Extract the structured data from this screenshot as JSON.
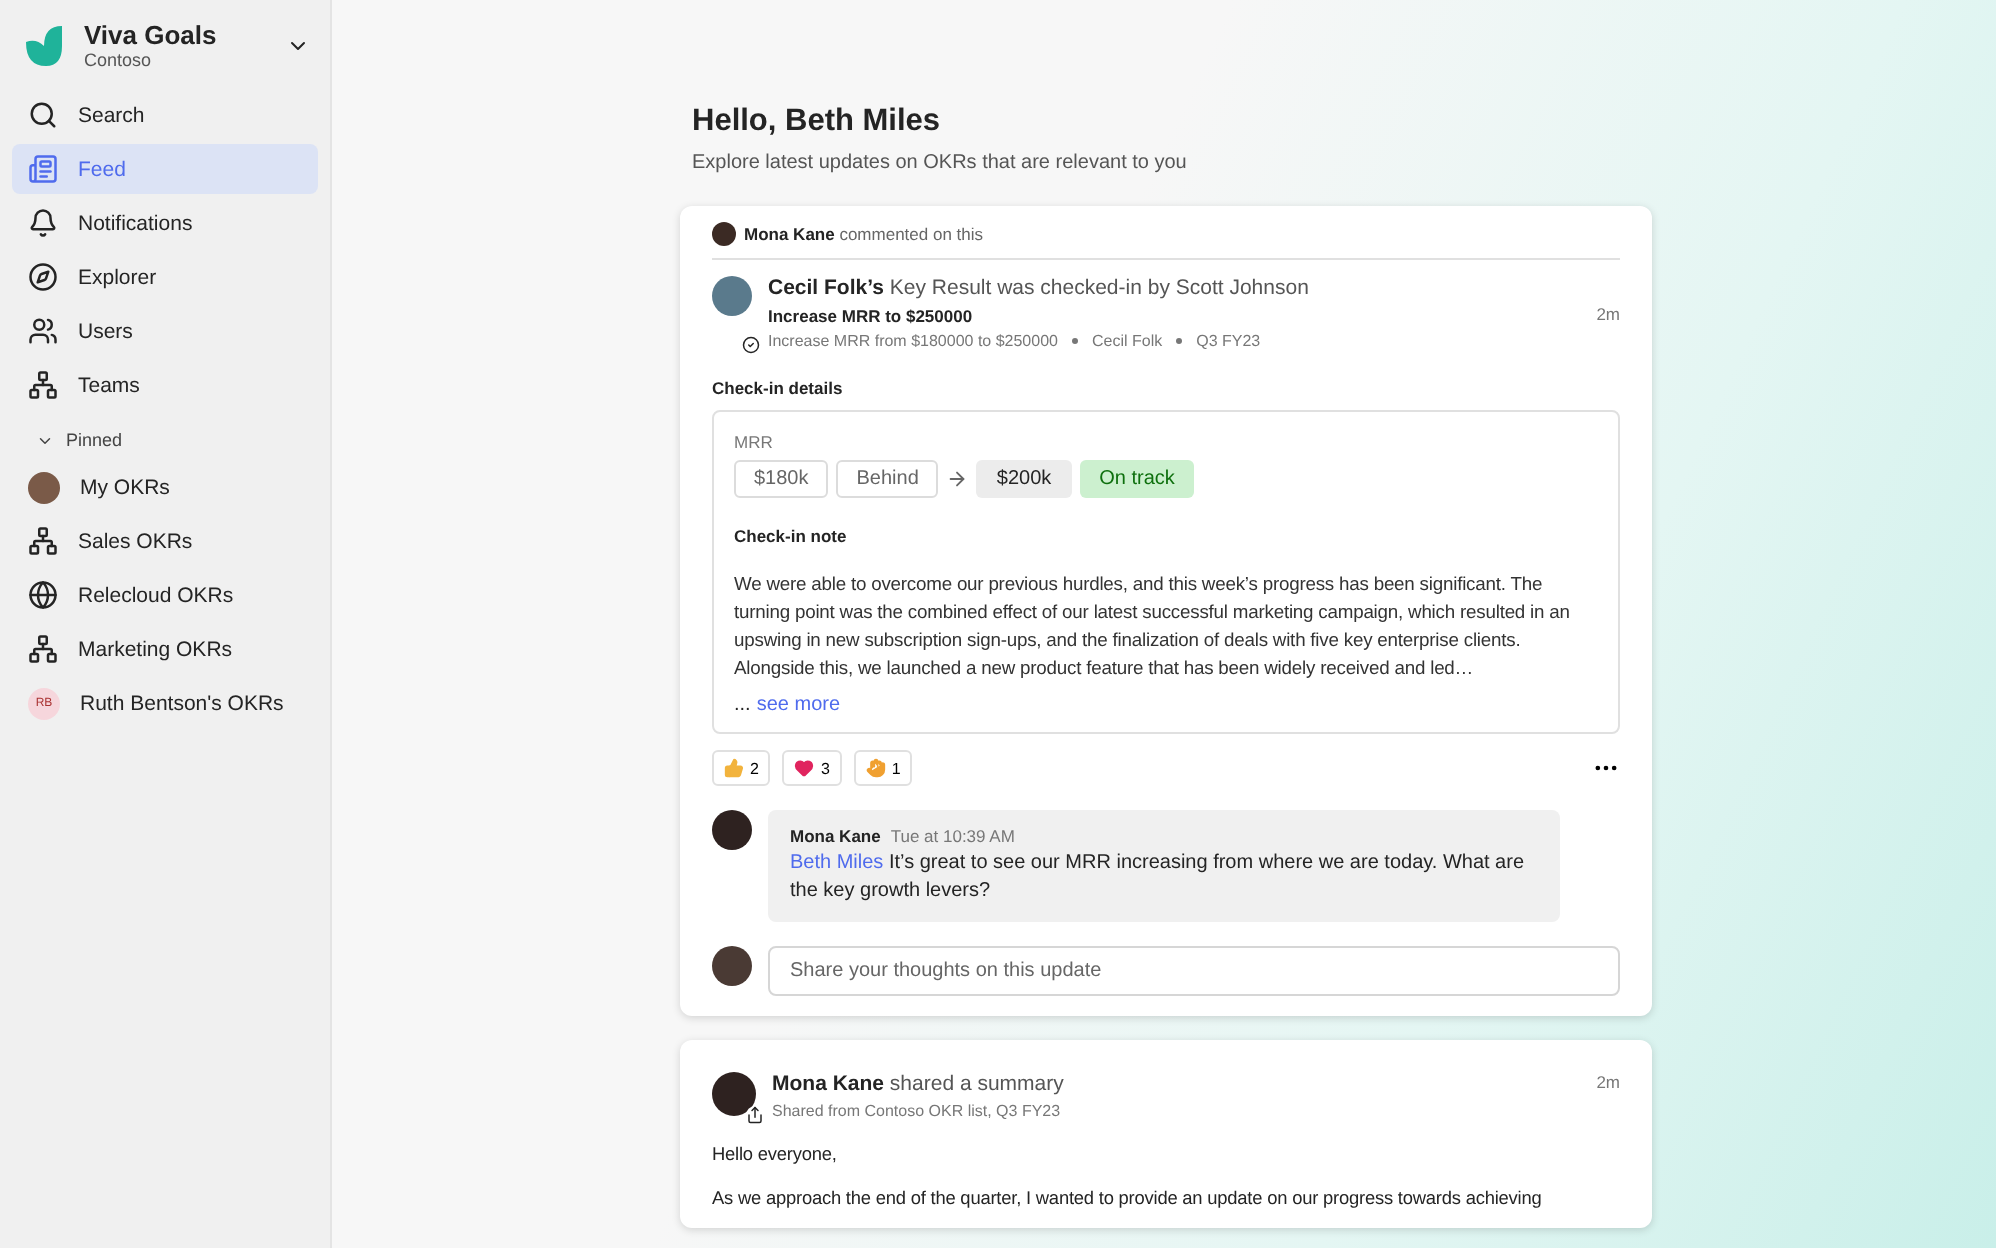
{
  "app": {
    "name": "Viva Goals",
    "org": "Contoso"
  },
  "nav": [
    {
      "label": "Search",
      "selected": false
    },
    {
      "label": "Feed",
      "selected": true
    },
    {
      "label": "Notifications",
      "selected": false
    },
    {
      "label": "Explorer",
      "selected": false
    },
    {
      "label": "Users",
      "selected": false
    },
    {
      "label": "Teams",
      "selected": false
    }
  ],
  "pinned": {
    "label": "Pinned",
    "expanded": true,
    "items": [
      {
        "label": "My OKRs",
        "kind": "photo"
      },
      {
        "label": "Sales OKRs",
        "kind": "org"
      },
      {
        "label": "Relecloud OKRs",
        "kind": "globe"
      },
      {
        "label": "Marketing OKRs",
        "kind": "org"
      },
      {
        "label": "Ruth Bentson's OKRs",
        "kind": "initials",
        "initials": "RB"
      }
    ]
  },
  "greeting": {
    "title": "Hello, Beth Miles",
    "subtitle": "Explore latest updates on OKRs that are relevant to you"
  },
  "posts": [
    {
      "kind": "checkin",
      "context": "**Mona Kane** commented on this",
      "headline": "**Cecil Folk’s** Key Result was checked-in by Scott Johnson",
      "key_result": "Increase MRR to $250000",
      "meta": [
        "Increase MRR from $180000 to $250000",
        "Cecil Folk",
        "Q3 FY23"
      ],
      "time": "2m",
      "details_label": "Check-in details",
      "metric": "MRR",
      "previous": {
        "value": "$180k",
        "status": "Behind"
      },
      "current": {
        "value": "$200k",
        "status": "On track"
      },
      "note_label": "Check-in note",
      "note": "We were able to overcome our previous hurdles, and this week’s progress has been significant. The turning point was the combined effect of our latest successful marketing campaign, which resulted in an upswing in new subscription sign-ups, and the finalization of deals with five key enterprise clients. Alongside this, we launched a new product feature that has been widely received and led…",
      "more_prefix": "...",
      "more": "see more",
      "reactions": [
        {
          "kind": "like",
          "count": "2"
        },
        {
          "kind": "heart",
          "count": "3"
        },
        {
          "kind": "clap",
          "count": "1"
        }
      ],
      "comment": {
        "author": "Mona Kane",
        "time": "Tue at 10:39 AM",
        "mention": "Beth Miles",
        "text": "It’s great to see our MRR increasing from where we are today. What are the key growth levers?"
      },
      "reply": {
        "placeholder": "Share your thoughts on this update"
      }
    },
    {
      "kind": "summary",
      "headline": "**Mona Kane** shared a summary",
      "source": "Shared from Contoso OKR list, Q3 FY23",
      "time": "2m",
      "paragraphs": [
        "Hello everyone,",
        "As we approach the end of the quarter, I wanted to provide an update on our progress towards achieving"
      ]
    }
  ]
}
